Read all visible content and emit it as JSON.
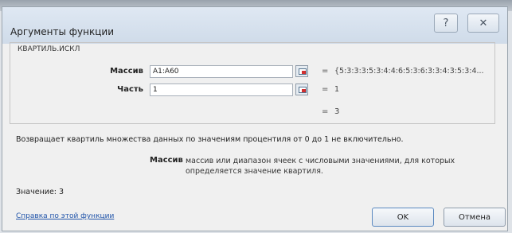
{
  "dialog": {
    "title": "Аргументы функции",
    "help_icon": "question-mark-icon",
    "close_icon": "close-x-icon"
  },
  "function": {
    "name": "КВАРТИЛЬ.ИСКЛ",
    "args": [
      {
        "label": "Массив",
        "value": "A1:A60",
        "result": "{5:3:3:3:5:3:4:4:6:5:3:6:3:3:4:3:5:3:4..."
      },
      {
        "label": "Часть",
        "value": "1",
        "result": "1"
      }
    ],
    "result": "3"
  },
  "description": "Возвращает квартиль множества данных по значениям процентиля от 0 до 1 не включительно.",
  "arg_description": {
    "name": "Массив",
    "text": "массив или диапазон ячеек с числовыми значениями, для которых определяется значение квартиля."
  },
  "value_line": "Значение: 3",
  "help_link": "Справка по этой функции",
  "buttons": {
    "ok": "OK",
    "cancel": "Отмена"
  },
  "symbols": {
    "equals": "=",
    "help_glyph": "?",
    "close_glyph": "✕",
    "result_prefix": "= "
  }
}
